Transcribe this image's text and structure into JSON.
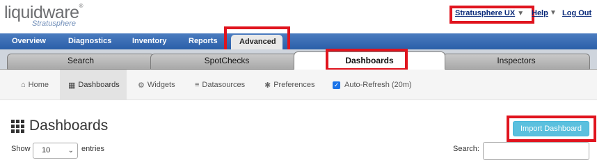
{
  "header": {
    "logo_main": "liquidware",
    "logo_tm": "®",
    "logo_sub": "Stratusphere",
    "user_name": "Stratusphere UX",
    "help_label": "Help",
    "logout_label": "Log Out"
  },
  "main_nav": {
    "items": [
      "Overview",
      "Diagnostics",
      "Inventory",
      "Reports",
      "Advanced"
    ],
    "active": "Advanced"
  },
  "sub_tabs": {
    "items": [
      "Search",
      "SpotChecks",
      "Dashboards",
      "Inspectors"
    ],
    "active": "Dashboards"
  },
  "toolbar": {
    "home": "Home",
    "dashboards": "Dashboards",
    "widgets": "Widgets",
    "datasources": "Datasources",
    "preferences": "Preferences",
    "auto_refresh": "Auto-Refresh (20m)",
    "auto_refresh_checked": true
  },
  "page": {
    "title": "Dashboards",
    "import_button": "Import Dashboard",
    "show_label": "Show",
    "entries_value": "10",
    "entries_label": "entries",
    "search_label": "Search:",
    "search_value": ""
  },
  "colors": {
    "nav_blue": "#2b5fa8",
    "highlight_red": "#e0141e",
    "import_button": "#5bc0de",
    "checkbox": "#1a73e8"
  }
}
